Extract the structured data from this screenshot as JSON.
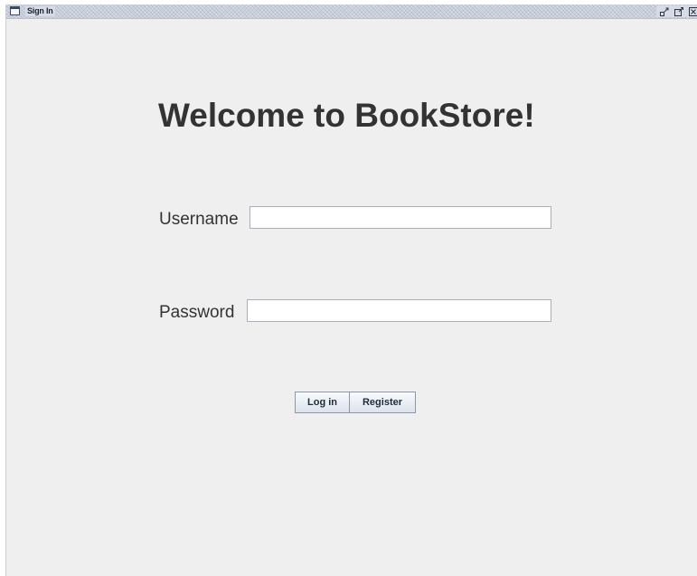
{
  "window": {
    "title": "Sign In"
  },
  "main": {
    "heading": "Welcome to BookStore!",
    "username_label": "Username",
    "username_value": "",
    "password_label": "Password",
    "password_value": ""
  },
  "buttons": {
    "login_label": "Log in",
    "register_label": "Register"
  },
  "icons": {
    "window_icon": "frame-icon",
    "iconify": "minimize-icon",
    "maximize": "maximize-icon",
    "close": "close-icon"
  },
  "colors": {
    "background": "#efefef",
    "text": "#333333",
    "titlebar": "#d6dbe5"
  }
}
